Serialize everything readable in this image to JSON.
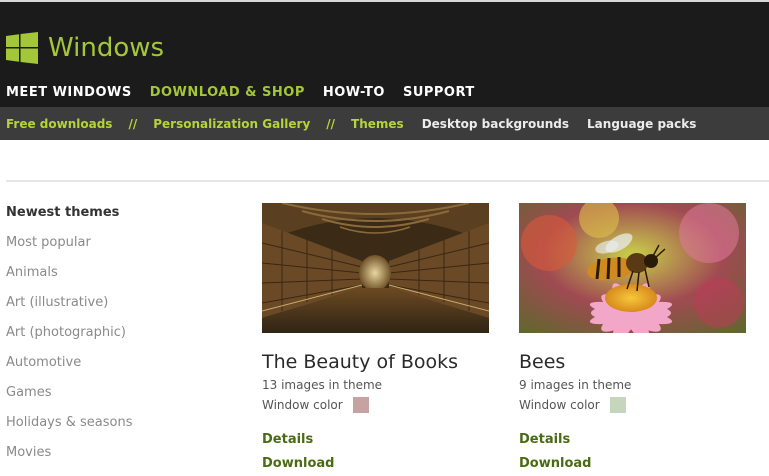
{
  "header": {
    "logo_text": "Windows",
    "logo_color": "#a4c639",
    "nav": [
      {
        "label": "MEET WINDOWS",
        "active": false
      },
      {
        "label": "DOWNLOAD & SHOP",
        "active": true
      },
      {
        "label": "HOW-TO",
        "active": false
      },
      {
        "label": "SUPPORT",
        "active": false
      }
    ]
  },
  "subnav": {
    "items": [
      {
        "label": "Free downloads"
      },
      {
        "label": "Personalization Gallery"
      },
      {
        "label": "Themes"
      },
      {
        "label": "Desktop backgrounds"
      },
      {
        "label": "Language packs"
      }
    ],
    "separator": "//"
  },
  "categories": [
    {
      "label": "Newest themes",
      "selected": true
    },
    {
      "label": "Most popular"
    },
    {
      "label": "Animals"
    },
    {
      "label": "Art (illustrative)"
    },
    {
      "label": "Art (photographic)"
    },
    {
      "label": "Automotive"
    },
    {
      "label": "Games"
    },
    {
      "label": "Holidays & seasons"
    },
    {
      "label": "Movies"
    }
  ],
  "themes": [
    {
      "title": "The Beauty of Books",
      "image_count": "13 images in theme",
      "window_color_label": "Window color",
      "window_color": "#c7a2a2",
      "details_label": "Details",
      "download_label": "Download",
      "image": "library-photo"
    },
    {
      "title": "Bees",
      "image_count": "9 images in theme",
      "window_color_label": "Window color",
      "window_color": "#c5d6bc",
      "details_label": "Details",
      "download_label": "Download",
      "image": "bee-on-flower-photo"
    }
  ]
}
